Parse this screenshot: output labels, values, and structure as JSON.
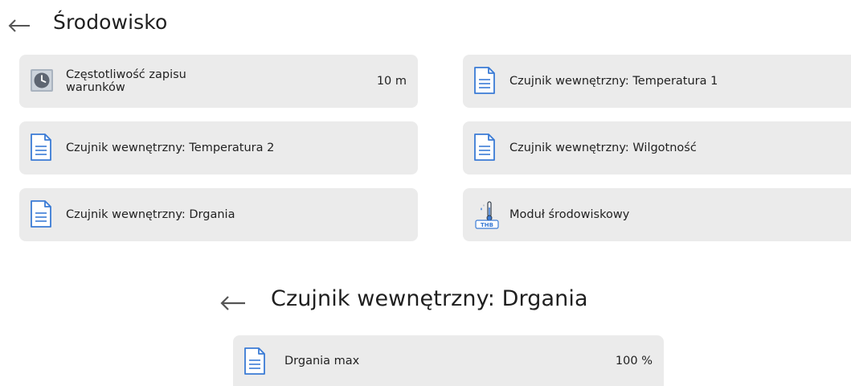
{
  "screen1": {
    "title": "Środowisko",
    "tiles": [
      {
        "label": "Częstotliwość zapisu warunków",
        "value": "10 m",
        "icon": "clock-icon"
      },
      {
        "label": "Czujnik wewnętrzny: Temperatura 1",
        "icon": "document-icon"
      },
      {
        "label": "Czujnik wewnętrzny: Temperatura 2",
        "icon": "document-icon"
      },
      {
        "label": "Czujnik wewnętrzny: Wilgotność",
        "icon": "document-icon"
      },
      {
        "label": "Czujnik wewnętrzny: Drgania",
        "icon": "document-icon"
      },
      {
        "label": "Moduł środowiskowy",
        "icon": "thb-module-icon",
        "icon_text": "THB"
      }
    ]
  },
  "screen2": {
    "title": "Czujnik wewnętrzny: Drgania",
    "tiles": [
      {
        "label": "Drgania max",
        "value": "100 %",
        "icon": "document-icon"
      }
    ]
  },
  "colors": {
    "tile_bg": "#ebebeb",
    "icon_blue": "#3a7bd5",
    "clock_gray": "#6d7580",
    "arrow_gray": "#555555"
  }
}
